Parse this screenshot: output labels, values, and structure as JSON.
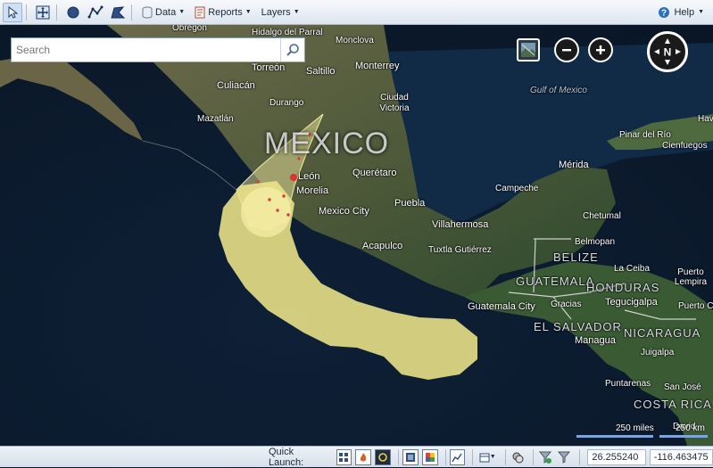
{
  "toolbar": {
    "data_label": "Data",
    "reports_label": "Reports",
    "layers_label": "Layers",
    "help_label": "Help"
  },
  "search": {
    "placeholder": "Search"
  },
  "map": {
    "labels": {
      "obregon": "Obregón",
      "hidalgo": "Hidalgo del Parral",
      "monclova": "Monclova",
      "torreon": "Torreón",
      "saltillo": "Saltillo",
      "monterrey": "Monterrey",
      "culiacan": "Culiacán",
      "durango": "Durango",
      "ciudad_victoria": "Ciudad Victoria",
      "mazatlan": "Mazatlán",
      "gulf": "Gulf of Mexico",
      "mexico": "MEXICO",
      "pinar": "Pinar del Río",
      "cienfuegos": "Cienfuegos",
      "havana": "Hav",
      "merida": "Mérida",
      "leon": "León",
      "queretaro": "Querétaro",
      "morelia": "Morelia",
      "campeche": "Campeche",
      "mexico_city": "Mexico City",
      "puebla": "Puebla",
      "chetumal": "Chetumal",
      "villahermosa": "Villahermosa",
      "belmopan": "Belmopan",
      "acapulco": "Acapulco",
      "tuxtla": "Tuxtla Gutiérrez",
      "belize": "BELIZE",
      "la_ceiba": "La Ceiba",
      "puerto_lempira": "Puerto Lempira",
      "guatemala": "GUATEMALA",
      "honduras": "HONDURAS",
      "guatemala_city": "Guatemala City",
      "gracias": "Gracias",
      "tegucigalpa": "Tegucigalpa",
      "puerto_cabezas": "Puerto Cabe",
      "el_salvador": "EL SALVADOR",
      "managua": "Managua",
      "nicaragua": "NICARAGUA",
      "juigalpa": "Juigalpa",
      "puntarenas": "Puntarenas",
      "san_jose": "San José",
      "costa_rica": "COSTA RICA",
      "david": "David"
    },
    "scale": {
      "miles": "250 miles",
      "km": "250 km"
    }
  },
  "status": {
    "quick_launch_label": "Quick Launch:",
    "latitude": "26.255240",
    "longitude": "-116.463475"
  }
}
